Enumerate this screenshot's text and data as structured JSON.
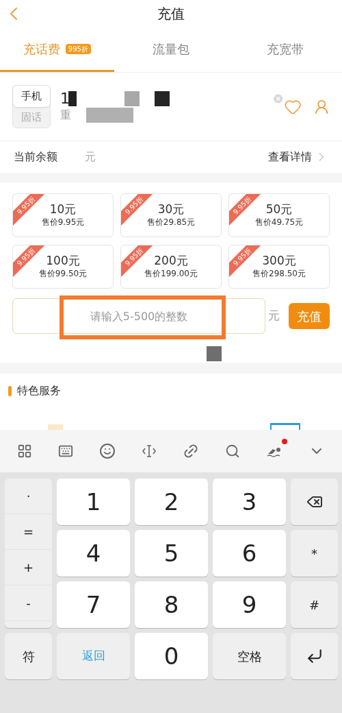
{
  "header": {
    "title": "充值"
  },
  "tabs": [
    {
      "label": "充话费",
      "selected": true,
      "badge": "995折"
    },
    {
      "label": "流量包",
      "selected": false
    },
    {
      "label": "充宽带",
      "selected": false
    }
  ],
  "phone": {
    "types": [
      {
        "label": "手机",
        "selected": true
      },
      {
        "label": "固话",
        "selected": false
      }
    ],
    "number": "1",
    "region": "重"
  },
  "balance": {
    "label": "当前余额",
    "unit": "元",
    "link": "查看详情"
  },
  "packages": [
    {
      "face": "10元",
      "price": "售价9.95元",
      "ribbon": "9.95折"
    },
    {
      "face": "30元",
      "price": "售价29.85元",
      "ribbon": "9.95折"
    },
    {
      "face": "50元",
      "price": "售价49.75元",
      "ribbon": "9.95折"
    },
    {
      "face": "100元",
      "price": "售价99.50元",
      "ribbon": "9.95折"
    },
    {
      "face": "200元",
      "price": "售价199.00元",
      "ribbon": "9.95折"
    },
    {
      "face": "300元",
      "price": "售价298.50元",
      "ribbon": "9.95折"
    }
  ],
  "custom_amount": {
    "placeholder": "请输入5-500的整数",
    "unit": "元",
    "button": "充值"
  },
  "section": {
    "title": "特色服务"
  },
  "keyboard": {
    "toolbar_notification": true,
    "side_keys": [
      "·",
      "=",
      "+",
      "-"
    ],
    "keys": [
      {
        "kind": "digit",
        "label": "1"
      },
      {
        "kind": "digit",
        "label": "2"
      },
      {
        "kind": "digit",
        "label": "3"
      },
      {
        "kind": "backspace"
      },
      {
        "kind": "digit",
        "label": "4"
      },
      {
        "kind": "digit",
        "label": "5"
      },
      {
        "kind": "digit",
        "label": "6"
      },
      {
        "kind": "function",
        "label": "*"
      },
      {
        "kind": "digit",
        "label": "7"
      },
      {
        "kind": "digit",
        "label": "8"
      },
      {
        "kind": "digit",
        "label": "9"
      },
      {
        "kind": "function",
        "label": "#"
      }
    ],
    "bottom_keys": [
      {
        "kind": "function",
        "label": "符"
      },
      {
        "kind": "back",
        "label": "返回"
      },
      {
        "kind": "digit",
        "label": "0"
      },
      {
        "kind": "function",
        "label": "空格"
      },
      {
        "kind": "enter"
      }
    ]
  }
}
